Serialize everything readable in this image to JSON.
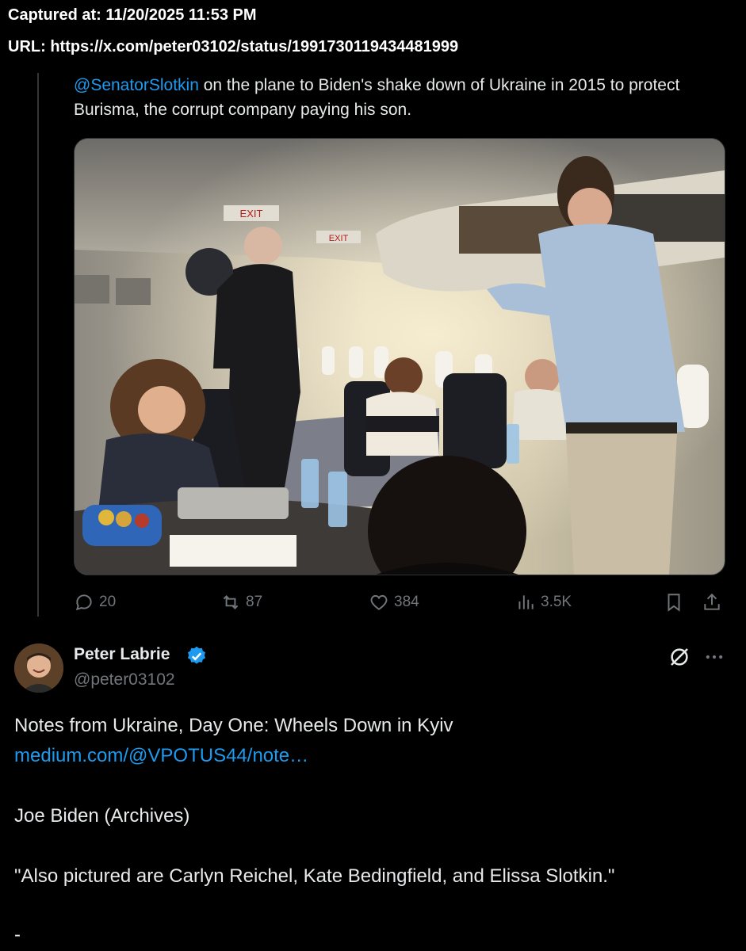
{
  "capture": {
    "captured_at": "Captured at: 11/20/2025 11:53 PM",
    "url": "URL: https://x.com/peter03102/status/1991730119434481999"
  },
  "parent_post": {
    "mention": "@SenatorSlotkin",
    "text": " on the plane to Biden's shake down of Ukraine in 2015 to protect Burisma, the corrupt company paying his son.",
    "image_signs": [
      "EXIT",
      "EXIT"
    ],
    "actions": {
      "replies": "20",
      "reposts": "87",
      "likes": "384",
      "views": "3.5K"
    }
  },
  "post": {
    "author_name": "Peter Labrie",
    "handle": "@peter03102",
    "lines": [
      "Notes from Ukraine, Day One: Wheels Down in Kyiv",
      "medium.com/@VPOTUS44/note…",
      "Joe Biden (Archives)",
      "\"Also pictured are Carlyn Reichel, Kate Bedingfield, and Elissa Slotkin.\"",
      "-"
    ]
  },
  "colors": {
    "background": "#000000",
    "text": "#e7e9ea",
    "muted": "#71767b",
    "accent": "#1d9bf0"
  },
  "icons": [
    "reply-icon",
    "repost-icon",
    "like-icon",
    "views-icon",
    "bookmark-icon",
    "share-icon",
    "verified-badge-icon",
    "grok-icon",
    "more-icon"
  ]
}
